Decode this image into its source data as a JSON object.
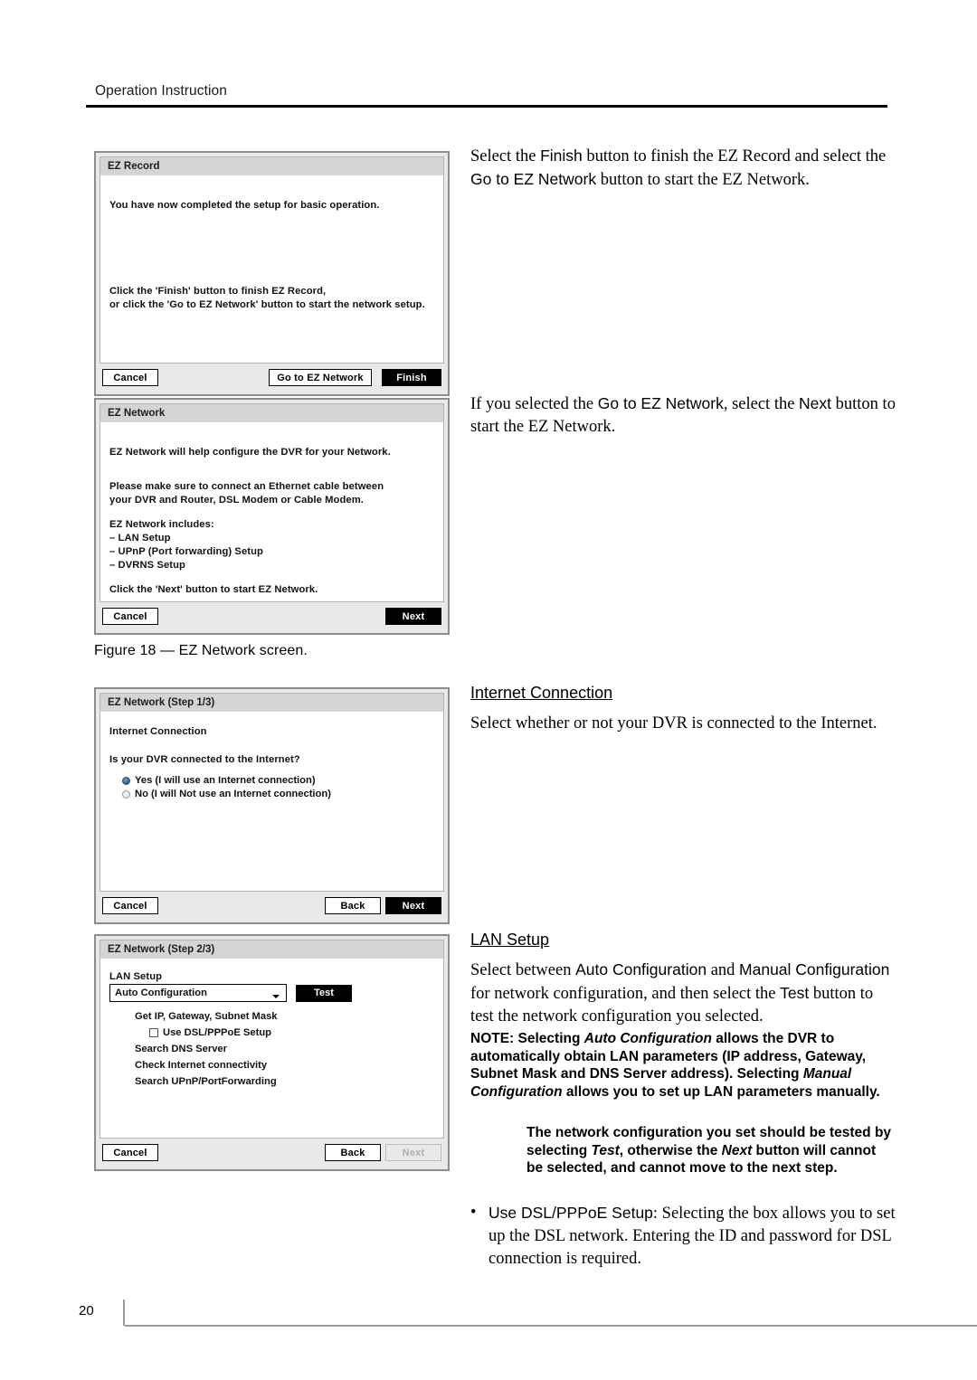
{
  "page": {
    "header_title": "Operation Instruction",
    "page_number": "20"
  },
  "figure": {
    "caption": "Figure 18 — EZ Network screen."
  },
  "dialogs": [
    {
      "id": "ez-record",
      "title": "EZ Record",
      "lines": [
        "You have now completed the setup for basic operation.",
        "Click the 'Finish' button to finish EZ Record,",
        "or click the 'Go to EZ Network' button to start the network setup."
      ],
      "buttons": {
        "cancel": "Cancel",
        "goto": "Go to EZ Network",
        "finish": "Finish"
      }
    },
    {
      "id": "ez-network",
      "title": "EZ Network",
      "lines": [
        "EZ Network will help configure the DVR for your Network.",
        "Please make sure to connect an Ethernet cable between",
        "your DVR and Router, DSL Modem or Cable Modem.",
        "EZ Network includes:",
        "– LAN Setup",
        "– UPnP (Port forwarding) Setup",
        "– DVRNS Setup",
        "Click the 'Next' button to start EZ Network."
      ],
      "buttons": {
        "cancel": "Cancel",
        "next": "Next"
      }
    },
    {
      "id": "ez-network-step1",
      "title": "EZ Network (Step 1/3)",
      "section_label": "Internet Connection",
      "question": "Is your DVR connected to the Internet?",
      "options": [
        {
          "label": "Yes (I will use an Internet connection)",
          "selected": true
        },
        {
          "label": "No (I will Not use an Internet connection)",
          "selected": false
        }
      ],
      "buttons": {
        "cancel": "Cancel",
        "back": "Back",
        "next": "Next"
      }
    },
    {
      "id": "ez-network-step2",
      "title": "EZ Network (Step 2/3)",
      "section_label": "LAN Setup",
      "select_value": "Auto Configuration",
      "test_button": "Test",
      "steps": [
        "Get IP, Gateway, Subnet Mask",
        "Search DNS Server",
        "Check Internet connectivity",
        "Search UPnP/PortForwarding"
      ],
      "checkbox": {
        "label": "Use DSL/PPPoE Setup",
        "checked": false
      },
      "buttons": {
        "cancel": "Cancel",
        "back": "Back",
        "next": "Next"
      }
    }
  ],
  "body": {
    "para1_a": "Select the ",
    "para1_ui1": "Finish",
    "para1_b": " button to finish the EZ Record and select the ",
    "para1_ui2": "Go to EZ Network",
    "para1_c": " button to start the EZ Network.",
    "para2_a": "If you selected the ",
    "para2_ui1": "Go to EZ Network",
    "para2_b": ", select the ",
    "para2_ui2": "Next",
    "para2_c": " button to start the EZ Network.",
    "heading_internet": "Internet Connection",
    "para3": "Select whether or not your DVR is connected to the Internet.",
    "heading_lan": "LAN Setup",
    "para4_a": "Select between ",
    "para4_ui1": "Auto Configuration",
    "para4_b": " and ",
    "para4_ui2": "Manual Configuration",
    "para4_c": " for network configuration, and then select the ",
    "para4_ui3": "Test",
    "para4_d": " button to test the network configuration you selected.",
    "note_label": "NOTE:",
    "note_p1_a": "Selecting ",
    "note_p1_i1": "Auto Configuration",
    "note_p1_b": " allows the DVR to automatically obtain LAN parameters (IP address, Gateway, Subnet Mask and DNS Server address). Selecting ",
    "note_p1_i2": "Manual Configuration",
    "note_p1_c": " allows you to set up LAN parameters manually.",
    "note_p2_a": "The network configuration you set should be tested by selecting ",
    "note_p2_i1": "Test",
    "note_p2_b": ", otherwise the ",
    "note_p2_i2": "Next",
    "note_p2_c": " button will cannot be selected, and cannot move to the next step.",
    "bullet_dot": "•",
    "bullet_ui": "Use DSL/PPPoE Setup",
    "bullet_text": ":  Selecting the box allows you to set up the DSL network.  Entering the ID and password for DSL connection is required."
  }
}
